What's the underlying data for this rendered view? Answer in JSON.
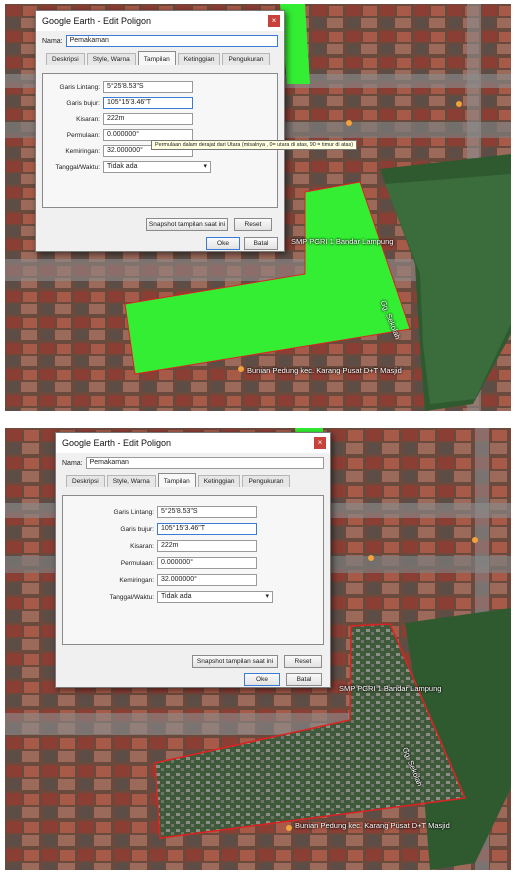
{
  "dialog": {
    "title": "Google Earth - Edit Poligon",
    "close_glyph": "×",
    "name_label": "Nama:",
    "name_value": "Pemakaman",
    "tabs": [
      "Deskripsi",
      "Style, Warna",
      "Tampilan",
      "Ketinggian",
      "Pengukuran"
    ],
    "active_tab": "Tampilan",
    "fields": {
      "lat_label": "Garis Lintang:",
      "lat_value": "5°25'8.53\"S",
      "lon_label": "Garis bujur:",
      "lon_value": "105°15'3.46\"T",
      "range_label": "Kisaran:",
      "range_value": "222m",
      "heading_label": "Permulaan:",
      "heading_value": "0.000000°",
      "tilt_label": "Kemiringan:",
      "tilt_value": "32.000000°",
      "date_label": "Tanggal/Waktu:",
      "date_value": "Tidak ada"
    },
    "snapshot_button": "Snapshot tampilan saat ini",
    "reset_button": "Reset",
    "ok_button": "Oke",
    "cancel_button": "Batal"
  },
  "tooltip": "Permulaan dalam derajat dari Utara (misalnya , 0= utara di atas, 90 = timur di atas)",
  "map_labels": {
    "school": "SMP PGRI 1 Bandar Lampung",
    "school_top": "SMP PGRI 1 Bandar Lampung",
    "mosque": "Bunian Pedung kec. Karang Pusat D+T Masjid",
    "mosque_top": "Bunian Pedung kec. Karang Pusat D+T Masjid",
    "street": "Gg. Sekolah",
    "street_top": "Gg. Sekolah"
  },
  "colors": {
    "polygon_fill": "#33ee33",
    "polygon_outline": "#dd2222",
    "dialog_bg": "#f0f0f0",
    "close_button": "#c8423b"
  },
  "icons": {
    "close": "close-icon",
    "dropdown": "chevron-down-icon",
    "place": "place-marker-icon"
  }
}
